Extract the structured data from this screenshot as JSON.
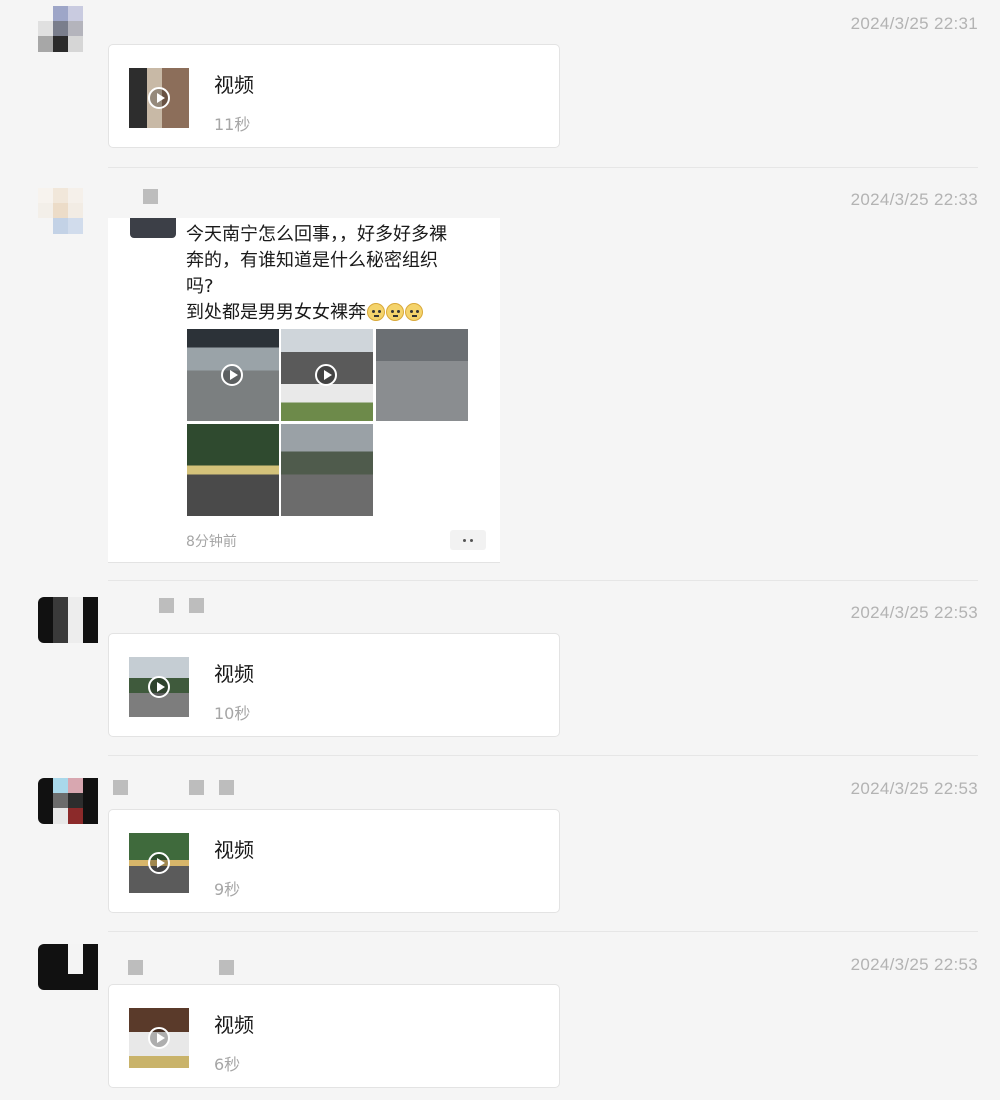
{
  "messages": [
    {
      "time": "2024/3/25 22:31",
      "card": {
        "title": "视频",
        "duration": "11秒"
      }
    },
    {
      "time": "2024/3/25 22:33",
      "post": {
        "text_line1": "今天南宁怎么回事，，好多好多裸",
        "text_line2": "奔的，有谁知道是什么秘密组织",
        "text_line3": "吗?",
        "text_line4": "到处都是男男女女裸奔",
        "emoji_count": 3,
        "image_count": 5,
        "ago": "8分钟前"
      }
    },
    {
      "time": "2024/3/25 22:53",
      "card": {
        "title": "视频",
        "duration": "10秒"
      }
    },
    {
      "time": "2024/3/25 22:53",
      "card": {
        "title": "视频",
        "duration": "9秒"
      }
    },
    {
      "time": "2024/3/25 22:53",
      "card": {
        "title": "视频",
        "duration": "6秒"
      }
    }
  ],
  "icons": {
    "play": "play-icon",
    "more": "more-dots-icon",
    "emoji": "worried-face-emoji"
  }
}
